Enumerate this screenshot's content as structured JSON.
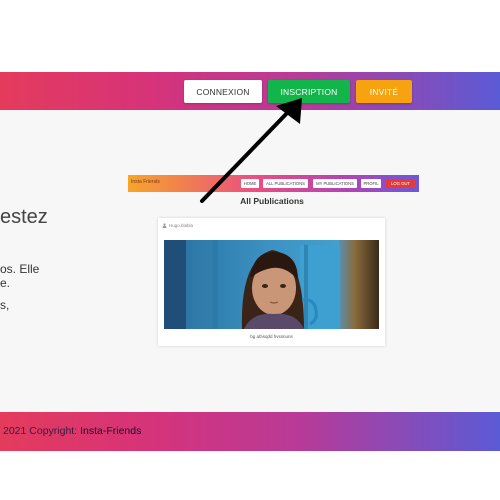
{
  "navbar": {
    "login_label": "CONNEXION",
    "signup_label": "INSCRIPTION",
    "guest_label": "INVITÉ"
  },
  "hero": {
    "title_fragment": "estez",
    "line1": "os. Elle",
    "line2": "e.",
    "line3": "s,"
  },
  "preview": {
    "brand": "Insta Friends",
    "nav": [
      "HOME",
      "ALL PUBLICATIONS",
      "MY PUBLICATIONS",
      "PROFIL",
      "LOG OUT"
    ],
    "page_title": "All Publications",
    "post": {
      "username": "Hugo.blabla",
      "caption": "bg ab\\sqdd hvssnuns"
    }
  },
  "footer": {
    "copyright": "2021 Copyright: ",
    "brand": "Insta-Friends"
  },
  "colors": {
    "signup": "#12b54a",
    "guest": "#f7a20f",
    "logout": "#e53a3a"
  }
}
